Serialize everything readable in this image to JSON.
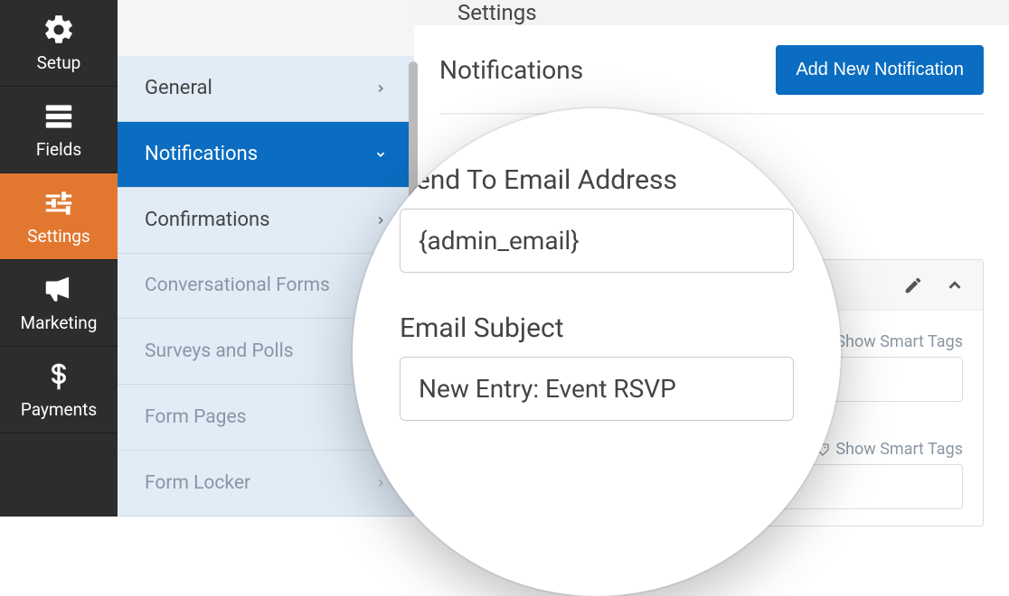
{
  "mainNav": {
    "setup": "Setup",
    "fields": "Fields",
    "settings": "Settings",
    "marketing": "Marketing",
    "payments": "Payments"
  },
  "subNav": {
    "general": "General",
    "notifications": "Notifications",
    "confirmations": "Confirmations",
    "conversational": "Conversational Forms",
    "surveys": "Surveys and Polls",
    "formPages": "Form Pages",
    "formLocker": "Form Locker"
  },
  "tab": {
    "label": "Settings"
  },
  "notifications": {
    "title": "Notifications",
    "addButton": "Add New Notification",
    "smartTags": "Show Smart Tags"
  },
  "magnifier": {
    "sendToLabel": "Send To Email Address",
    "sendToValue": "{admin_email}",
    "subjectLabel": "Email Subject",
    "subjectValue": "New Entry: Event RSVP"
  }
}
